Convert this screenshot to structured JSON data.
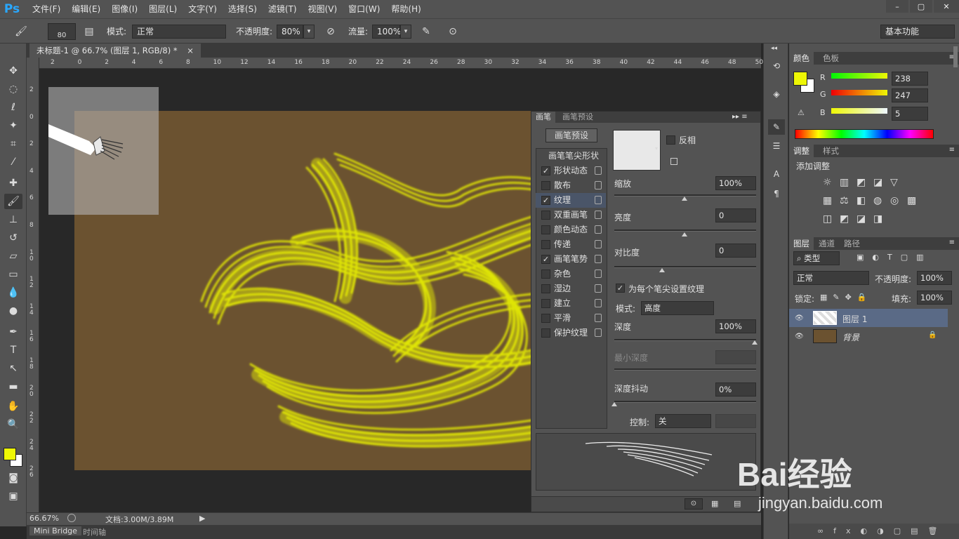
{
  "app": {
    "logo": "Ps"
  },
  "menu": [
    "文件(F)",
    "编辑(E)",
    "图像(I)",
    "图层(L)",
    "文字(Y)",
    "选择(S)",
    "滤镜(T)",
    "视图(V)",
    "窗口(W)",
    "帮助(H)"
  ],
  "options": {
    "brush_size": "80",
    "mode_label": "模式:",
    "mode_value": "正常",
    "opacity_label": "不透明度:",
    "opacity_value": "80%",
    "flow_label": "流量:",
    "flow_value": "100%",
    "workspace": "基本功能"
  },
  "document": {
    "tab_title": "未标题-1 @ 66.7% (图层 1, RGB/8) *",
    "zoom": "66.67%",
    "doc_info": "文档:3.00M/3.89M",
    "h_ruler": [
      "2",
      "0",
      "2",
      "4",
      "6",
      "8",
      "10",
      "12",
      "14",
      "16",
      "18",
      "20",
      "22",
      "24",
      "26",
      "28",
      "30",
      "32",
      "34",
      "36",
      "38",
      "40",
      "42",
      "44",
      "46",
      "48",
      "50"
    ],
    "v_ruler": [
      "2",
      "0",
      "2",
      "4",
      "6",
      "8",
      "1\n0",
      "1\n2",
      "1\n4",
      "1\n6",
      "1\n8",
      "2\n0",
      "2\n2",
      "2\n4",
      "2\n6"
    ],
    "canvas_color": "#6b5230",
    "stroke_color": "#eef700"
  },
  "bottom_tabs": [
    "Mini Bridge",
    "时间轴"
  ],
  "brush_panel": {
    "tabs": [
      "画笔",
      "画笔预设"
    ],
    "preset_button": "画笔预设",
    "tip_shape": "画笔笔尖形状",
    "items": [
      {
        "label": "形状动态",
        "checked": true
      },
      {
        "label": "散布",
        "checked": false
      },
      {
        "label": "纹理",
        "checked": true
      },
      {
        "label": "双重画笔",
        "checked": false
      },
      {
        "label": "颜色动态",
        "checked": false
      },
      {
        "label": "传递",
        "checked": false
      },
      {
        "label": "画笔笔势",
        "checked": true
      },
      {
        "label": "杂色",
        "checked": false
      },
      {
        "label": "湿边",
        "checked": false
      },
      {
        "label": "建立",
        "checked": false
      },
      {
        "label": "平滑",
        "checked": false
      },
      {
        "label": "保护纹理",
        "checked": false
      }
    ],
    "invert": "反相",
    "scale_label": "缩放",
    "scale_value": "100%",
    "brightness_label": "亮度",
    "brightness_value": "0",
    "contrast_label": "对比度",
    "contrast_value": "0",
    "per_tip": "为每个笔尖设置纹理",
    "mode_label": "模式:",
    "mode_value": "高度",
    "depth_label": "深度",
    "depth_value": "100%",
    "min_depth_label": "最小深度",
    "depth_jitter_label": "深度抖动",
    "depth_jitter_value": "0%",
    "control_label": "控制:",
    "control_value": "关"
  },
  "color_panel": {
    "tabs": [
      "颜色",
      "色板"
    ],
    "r_label": "R",
    "r": "238",
    "g_label": "G",
    "g": "247",
    "b_label": "B",
    "b": "5",
    "fg": "#eef705"
  },
  "adjust_panel": {
    "tabs": [
      "调整",
      "样式"
    ],
    "title": "添加调整"
  },
  "layers_panel": {
    "tabs": [
      "图层",
      "通道",
      "路径"
    ],
    "filter": "类型",
    "blend": "正常",
    "opacity_label": "不透明度:",
    "opacity": "100%",
    "lock_label": "锁定:",
    "fill_label": "填充:",
    "fill": "100%",
    "layers": [
      {
        "name": "图层 1",
        "selected": true
      },
      {
        "name": "背景",
        "selected": false
      }
    ]
  },
  "watermark": {
    "text": "Bai经验",
    "url": "jingyan.baidu.com"
  }
}
